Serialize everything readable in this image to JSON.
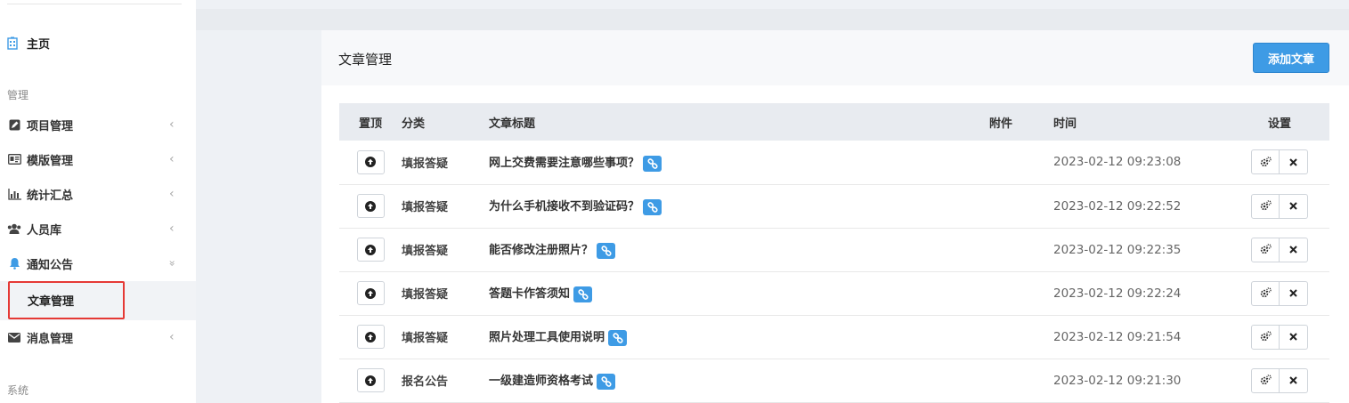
{
  "sidebar": {
    "home_label": "主页",
    "section_manage": "管理",
    "section_system": "系统",
    "items": [
      {
        "label": "项目管理",
        "icon": "edit-icon",
        "chevron": "‹"
      },
      {
        "label": "模版管理",
        "icon": "id-card-icon",
        "chevron": "‹"
      },
      {
        "label": "统计汇总",
        "icon": "bar-chart-icon",
        "chevron": "‹"
      },
      {
        "label": "人员库",
        "icon": "users-icon",
        "chevron": "‹"
      },
      {
        "label": "通知公告",
        "icon": "bell-icon",
        "chevron": "»"
      },
      {
        "label": "消息管理",
        "icon": "envelope-icon",
        "chevron": "‹"
      }
    ],
    "active_sub": "文章管理"
  },
  "panel": {
    "title": "文章管理",
    "add_button": "添加文章"
  },
  "table": {
    "headers": [
      "置顶",
      "分类",
      "文章标题",
      "附件",
      "时间",
      "设置"
    ],
    "rows": [
      {
        "category": "填报答疑",
        "title": "网上交费需要注意哪些事项？",
        "attachment": "",
        "time": "2023-02-12 09:23:08"
      },
      {
        "category": "填报答疑",
        "title": "为什么手机接收不到验证码？",
        "attachment": "",
        "time": "2023-02-12 09:22:52"
      },
      {
        "category": "填报答疑",
        "title": "能否修改注册照片？",
        "attachment": "",
        "time": "2023-02-12 09:22:35"
      },
      {
        "category": "填报答疑",
        "title": "答题卡作答须知",
        "attachment": "",
        "time": "2023-02-12 09:22:24"
      },
      {
        "category": "填报答疑",
        "title": "照片处理工具使用说明",
        "attachment": "",
        "time": "2023-02-12 09:21:54"
      },
      {
        "category": "报名公告",
        "title": "一级建造师资格考试",
        "attachment": "",
        "time": "2023-02-12 09:21:30"
      }
    ]
  },
  "colors": {
    "accent": "#3e9be5",
    "highlight_border": "#e53935"
  }
}
